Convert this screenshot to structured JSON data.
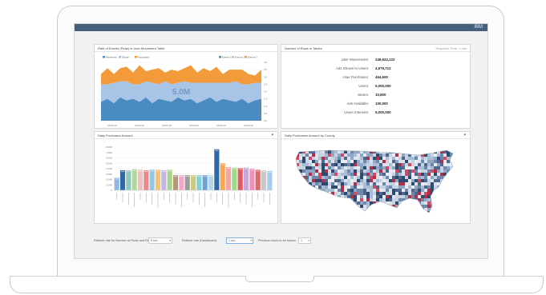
{
  "app": {
    "brand": "IBM",
    "colors": {
      "topbar": "#45607c",
      "series": [
        "#4a8cc2",
        "#a8c4e6",
        "#f39a3b"
      ]
    }
  },
  "area_panel": {
    "title": "Rate of Events (Peak) in User Movement Table",
    "legend": [
      "Movement",
      "Shown",
      "Purchases"
    ],
    "right_legend": [
      "Events 1",
      "Events 2",
      "Events 3"
    ],
    "overlay_value": "5.0M",
    "x_ticks": [
      "09:02:15",
      "09:02:30",
      "09:02:45",
      "09:03:00",
      "09:03:15",
      "09:03:30"
    ],
    "y_ticks": [
      "4.0",
      "3.5",
      "3.0",
      "2.5",
      "2.0",
      "1.5",
      "1.0",
      "0.5",
      "0.0"
    ]
  },
  "stats_panel": {
    "title": "Number of Rows in Tables",
    "info": "Snapshot Time: 1 min",
    "rows": [
      {
        "label": "User Movements:",
        "value": "249,624,122"
      },
      {
        "label": "Ads Shown to Users:",
        "value": "4,979,712"
      },
      {
        "label": "User Purchases:",
        "value": "464,600"
      },
      {
        "label": "Users:",
        "value": "5,000,000"
      },
      {
        "label": "Stores:",
        "value": "10,800"
      },
      {
        "label": "Ads Available:",
        "value": "100,000"
      },
      {
        "label": "Users Interests:",
        "value": "5,000,000"
      }
    ]
  },
  "bar_panel": {
    "title": "Daily Purchases Amount",
    "chevron": "▾",
    "y_ticks": [
      "8.00K",
      "7.00K",
      "6.00K",
      "5.00K",
      "4.00K",
      "3.00K",
      "2.00K",
      "1.00K",
      "0"
    ]
  },
  "map_panel": {
    "title": "Daily Purchases Amount by County",
    "chevron": "▾"
  },
  "controls": {
    "label1": "Refresh rate for Number of Rows and Resets",
    "select1": "5 sec",
    "label2": "Refresh rate (Dashboard)",
    "select2": "1 sec",
    "label3": "Previous hours to be shown",
    "select3": "1"
  },
  "chart_data": [
    {
      "type": "area",
      "title": "Rate of Events (Peak) in User Movement Table",
      "x": [
        "09:02:15",
        "09:02:30",
        "09:02:45",
        "09:03:00",
        "09:03:15",
        "09:03:30"
      ],
      "series": [
        {
          "name": "Movement",
          "values": [
            1.3,
            1.5,
            1.2,
            1.6,
            1.4,
            1.5,
            1.3,
            1.6,
            1.2,
            1.5,
            1.4,
            1.3,
            1.6,
            1.4,
            1.5,
            1.2,
            1.4,
            1.6,
            1.3,
            1.5,
            1.4,
            1.3,
            1.5,
            1.2,
            1.4,
            1.5
          ]
        },
        {
          "name": "Shown",
          "values": [
            1.2,
            1.0,
            1.4,
            1.1,
            1.3,
            1.0,
            1.2,
            1.1,
            1.4,
            1.0,
            1.3,
            1.2,
            1.0,
            1.3,
            1.1,
            1.4,
            1.2,
            1.0,
            1.3,
            1.1,
            1.2,
            1.4,
            1.0,
            1.3,
            1.2,
            1.1
          ]
        },
        {
          "name": "Purchases",
          "values": [
            0.7,
            1.1,
            0.6,
            0.9,
            1.0,
            0.8,
            1.3,
            0.7,
            0.9,
            1.1,
            0.6,
            1.0,
            0.8,
            0.9,
            1.2,
            0.7,
            1.0,
            0.8,
            1.1,
            0.6,
            0.9,
            0.8,
            1.0,
            0.7,
            0.5,
            0.9
          ]
        }
      ],
      "ylim": [
        0,
        4.0
      ],
      "grid": true,
      "legend": "top-left"
    },
    {
      "type": "bar",
      "title": "Daily Purchases Amount",
      "ylim": [
        0,
        8000
      ],
      "values": [
        2300,
        3700,
        3700,
        3900,
        3800,
        3700,
        3800,
        3800,
        3700,
        3800,
        2800,
        2800,
        2800,
        2800,
        2800,
        2800,
        2800,
        7600,
        5000,
        4300,
        4200,
        4100,
        4200,
        4000,
        3800,
        3700,
        3600
      ],
      "colors": [
        "#8fb7e6",
        "#2c6aa6",
        "#8dc8c0",
        "#aed99a",
        "#f0bfbf",
        "#e88a8a",
        "#8ec7e8",
        "#f4c07c",
        "#c8b4e0",
        "#a6d68e",
        "#b99679",
        "#f4a6c8",
        "#9c9c9c",
        "#c9cc7a",
        "#7fd1d6",
        "#6fa1d4",
        "#b7d4ef",
        "#2c6aa6",
        "#f7a84f",
        "#f4a6a6",
        "#9fd98a",
        "#e05a5a",
        "#c7a6df",
        "#f28fb8",
        "#d96b6b",
        "#c8c8c8",
        "#a9c9f0"
      ],
      "grid": true
    }
  ]
}
